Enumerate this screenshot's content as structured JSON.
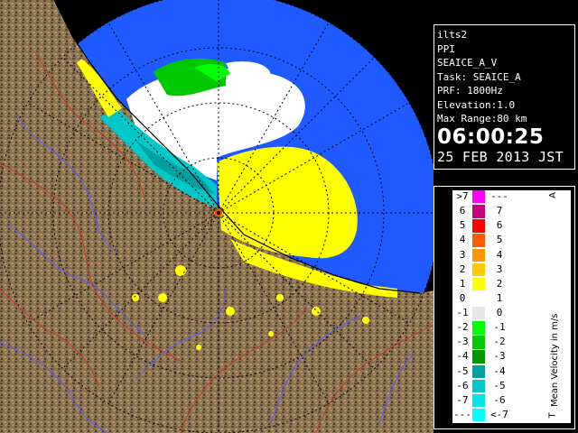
{
  "site": "ilts2",
  "scan_type": "PPI",
  "product": "SEAICE_A_V",
  "task_line": "Task: SEAICE_A",
  "prf_line": "PRF: 1800Hz",
  "elevation_line": "Elevation:1.0",
  "range_line": "Max Range:80 km",
  "time": "06:00:25",
  "date": "25 FEB 2013 JST",
  "legend": {
    "title": "Mean Velocity in m/s",
    "top_marker": "A",
    "bottom_marker": "T",
    "rows": [
      {
        "lo": ">7",
        "hi": "---",
        "color": "#ff00ff"
      },
      {
        "lo": "6",
        "hi": "7",
        "color": "#c8007e"
      },
      {
        "lo": "5",
        "hi": "6",
        "color": "#ff0000"
      },
      {
        "lo": "4",
        "hi": "5",
        "color": "#ff5a00"
      },
      {
        "lo": "3",
        "hi": "4",
        "color": "#ff9600"
      },
      {
        "lo": "2",
        "hi": "3",
        "color": "#ffc800"
      },
      {
        "lo": "1",
        "hi": "2",
        "color": "#ffff00"
      },
      {
        "lo": "0",
        "hi": "1",
        "color": "#ffffff"
      },
      {
        "lo": "-1",
        "hi": "0",
        "color": "#e6e6e6"
      },
      {
        "lo": "-2",
        "hi": "-1",
        "color": "#00ff00"
      },
      {
        "lo": "-3",
        "hi": "-2",
        "color": "#00c800"
      },
      {
        "lo": "-4",
        "hi": "-3",
        "color": "#009600"
      },
      {
        "lo": "-5",
        "hi": "-4",
        "color": "#00a0a0"
      },
      {
        "lo": "-6",
        "hi": "-5",
        "color": "#00c8c8"
      },
      {
        "lo": "-7",
        "hi": "-6",
        "color": "#00e6e6"
      },
      {
        "lo": "---",
        "hi": "<-7",
        "color": "#00ffff"
      }
    ]
  },
  "colors": {
    "sea": "#1e5aff",
    "land": "#8c7350",
    "range_rings": "#000000",
    "rivers": "#5050ff",
    "borders": "#c83232"
  }
}
